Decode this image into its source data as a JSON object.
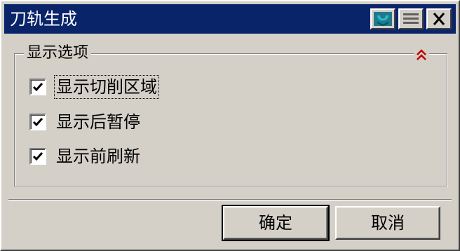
{
  "window": {
    "title": "刀轨生成",
    "title_bar_color": "#0a246a",
    "buttons": [
      "help-icon",
      "menu-icon",
      "close-icon"
    ]
  },
  "group": {
    "label": "显示选项",
    "collapse_icon": "double-chevron-up-icon",
    "collapse_icon_color": "#c00000"
  },
  "options": [
    {
      "label": "显示切削区域",
      "checked": true
    },
    {
      "label": "显示后暂停",
      "checked": true
    },
    {
      "label": "显示前刷新",
      "checked": true
    }
  ],
  "footer": {
    "ok_label": "确定",
    "cancel_label": "取消"
  }
}
